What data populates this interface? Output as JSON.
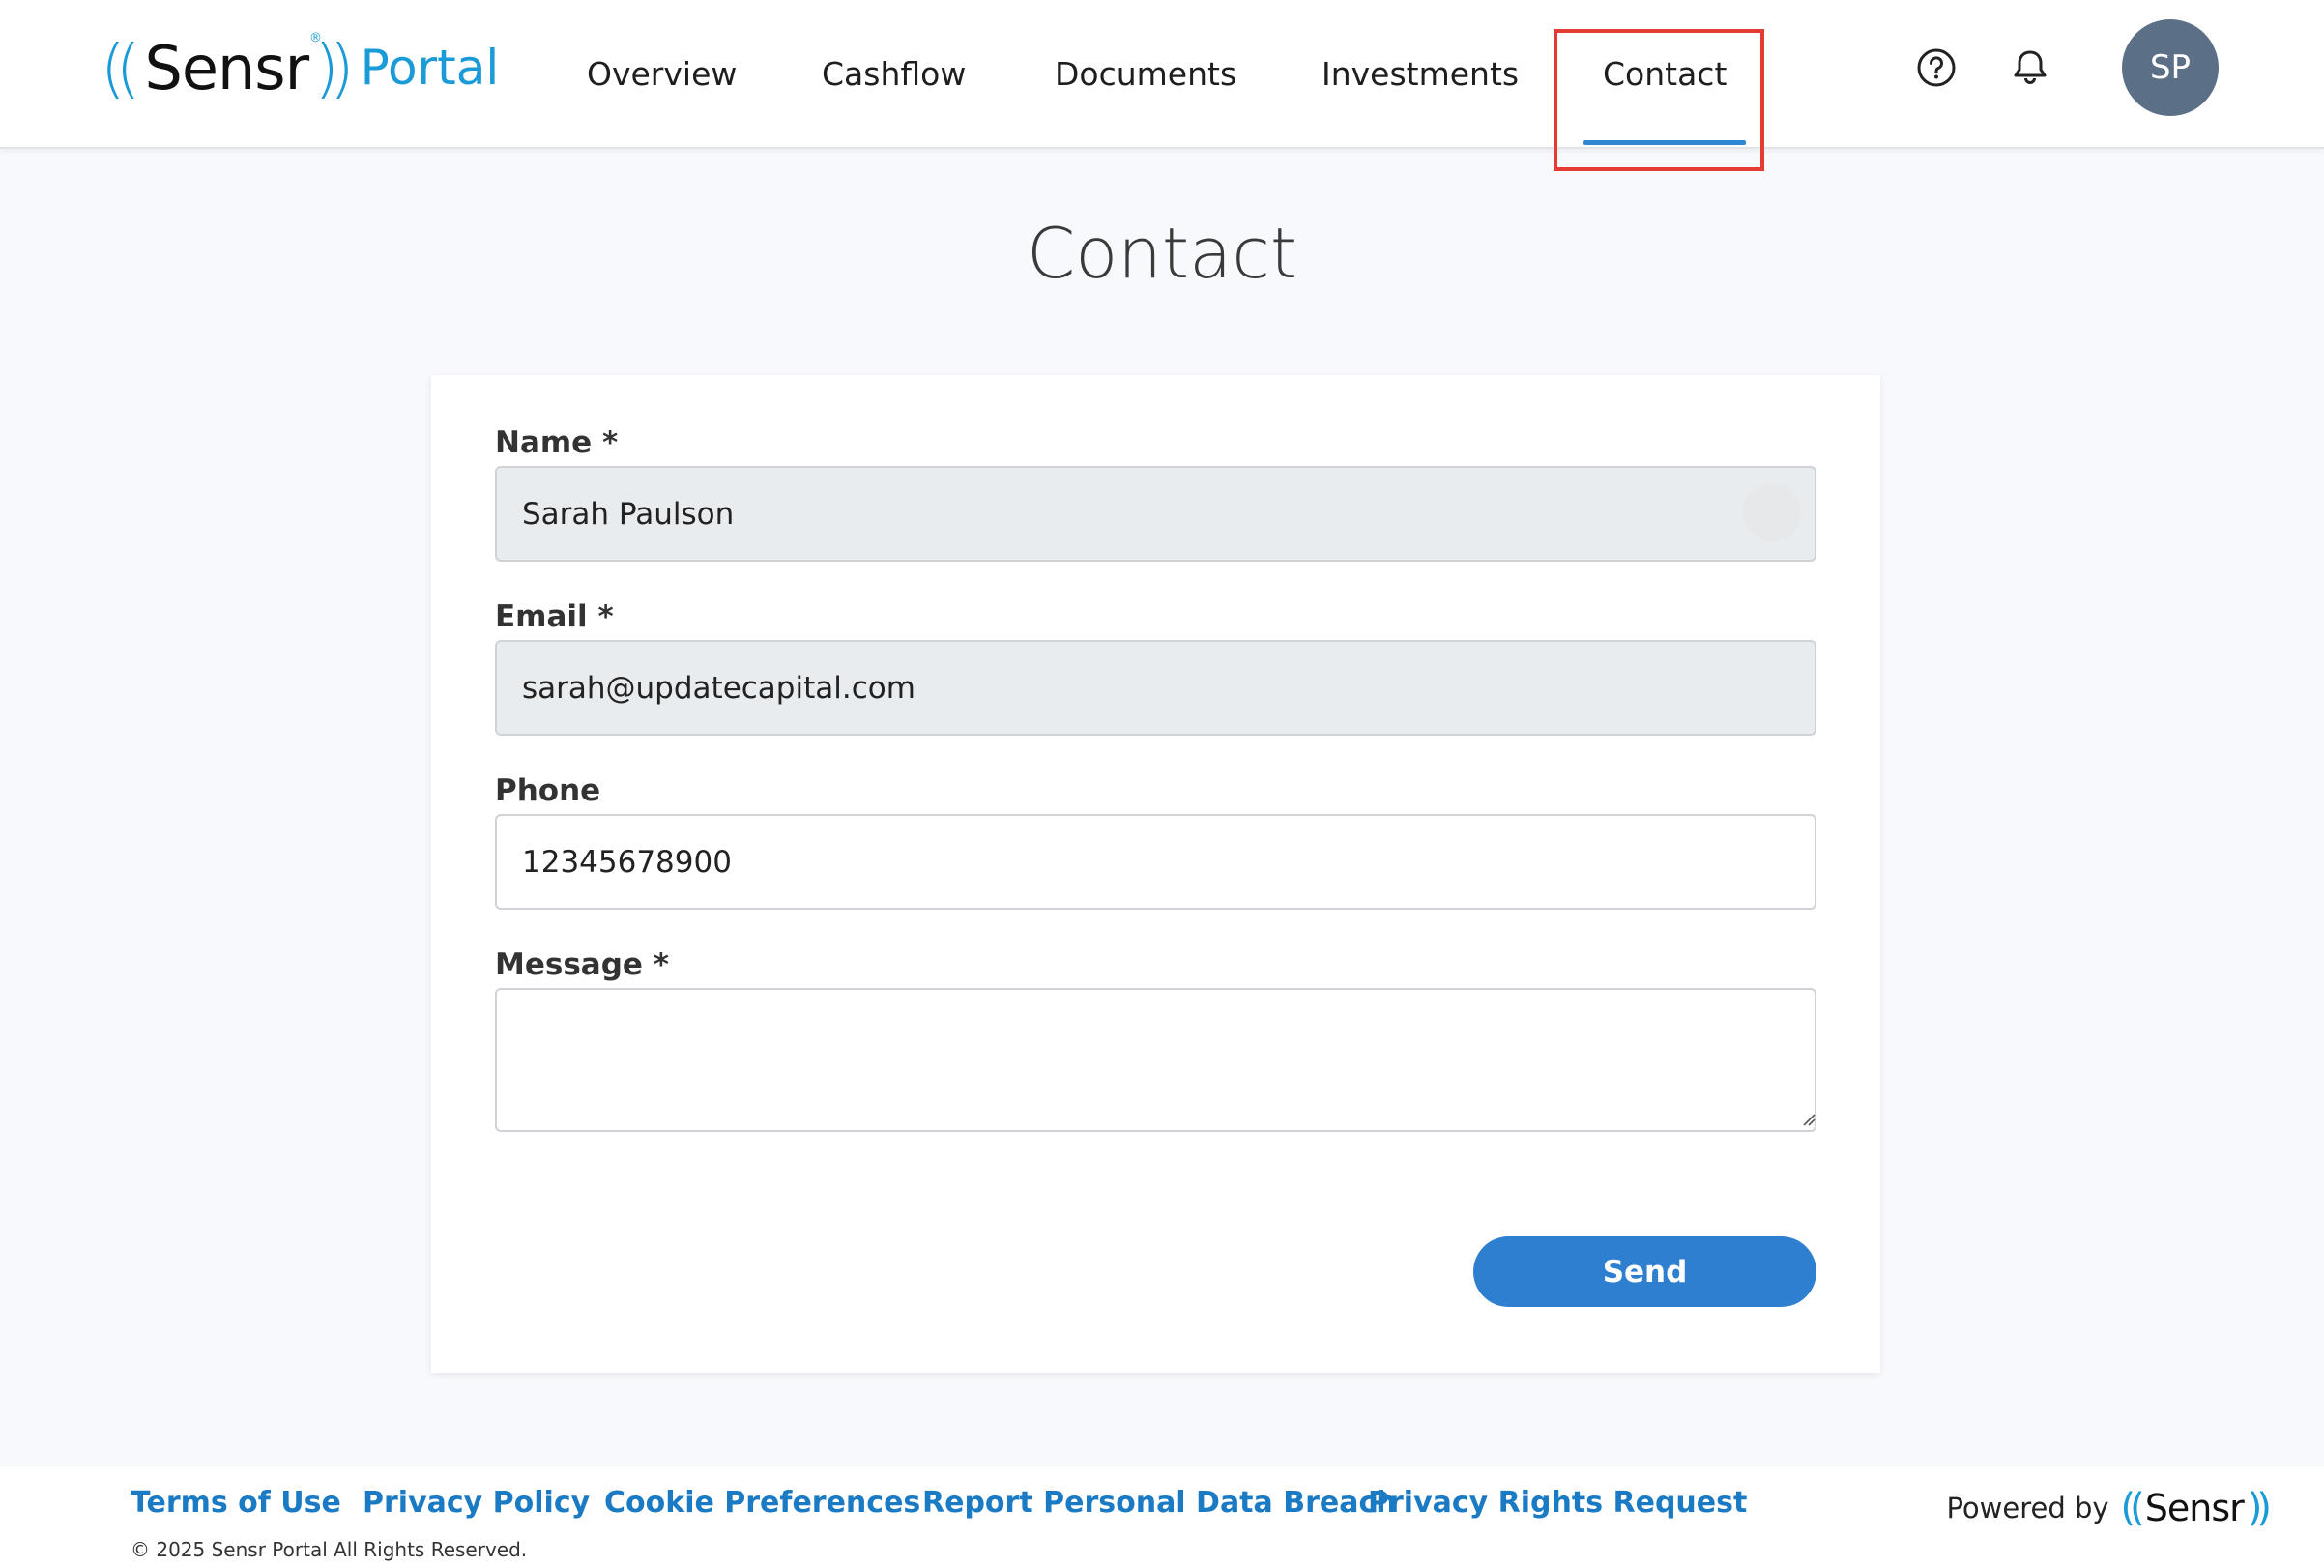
{
  "header": {
    "logo": {
      "brand": "Sensr",
      "reg_mark": "®",
      "product": "Portal"
    },
    "nav": [
      {
        "label": "Overview",
        "active": false
      },
      {
        "label": "Cashflow",
        "active": false
      },
      {
        "label": "Documents",
        "active": false
      },
      {
        "label": "Investments",
        "active": false
      },
      {
        "label": "Contact",
        "active": true
      }
    ],
    "help_icon": "question-circle-icon",
    "notifications_icon": "bell-icon",
    "avatar_initials": "SP"
  },
  "page": {
    "title": "Contact"
  },
  "form": {
    "name": {
      "label": "Name *",
      "value": "Sarah Paulson"
    },
    "email": {
      "label": "Email *",
      "value": "sarah@updatecapital.com"
    },
    "phone": {
      "label": "Phone",
      "value": "12345678900"
    },
    "message": {
      "label": "Message *",
      "value": ""
    },
    "send_label": "Send"
  },
  "footer": {
    "links": [
      "Terms of Use",
      "Privacy Policy",
      "Cookie Preferences",
      "Report Personal Data Breach",
      "Privacy Rights Request"
    ],
    "copyright": "© 2025 Sensr Portal All Rights Reserved.",
    "powered_by": "Powered by",
    "powered_brand": "Sensr"
  },
  "colors": {
    "accent": "#2f86d1",
    "brand_blue": "#1a9ad6",
    "avatar_bg": "#5b6f86",
    "highlight": "#e53b35",
    "readonly_bg": "#e9ecef"
  }
}
